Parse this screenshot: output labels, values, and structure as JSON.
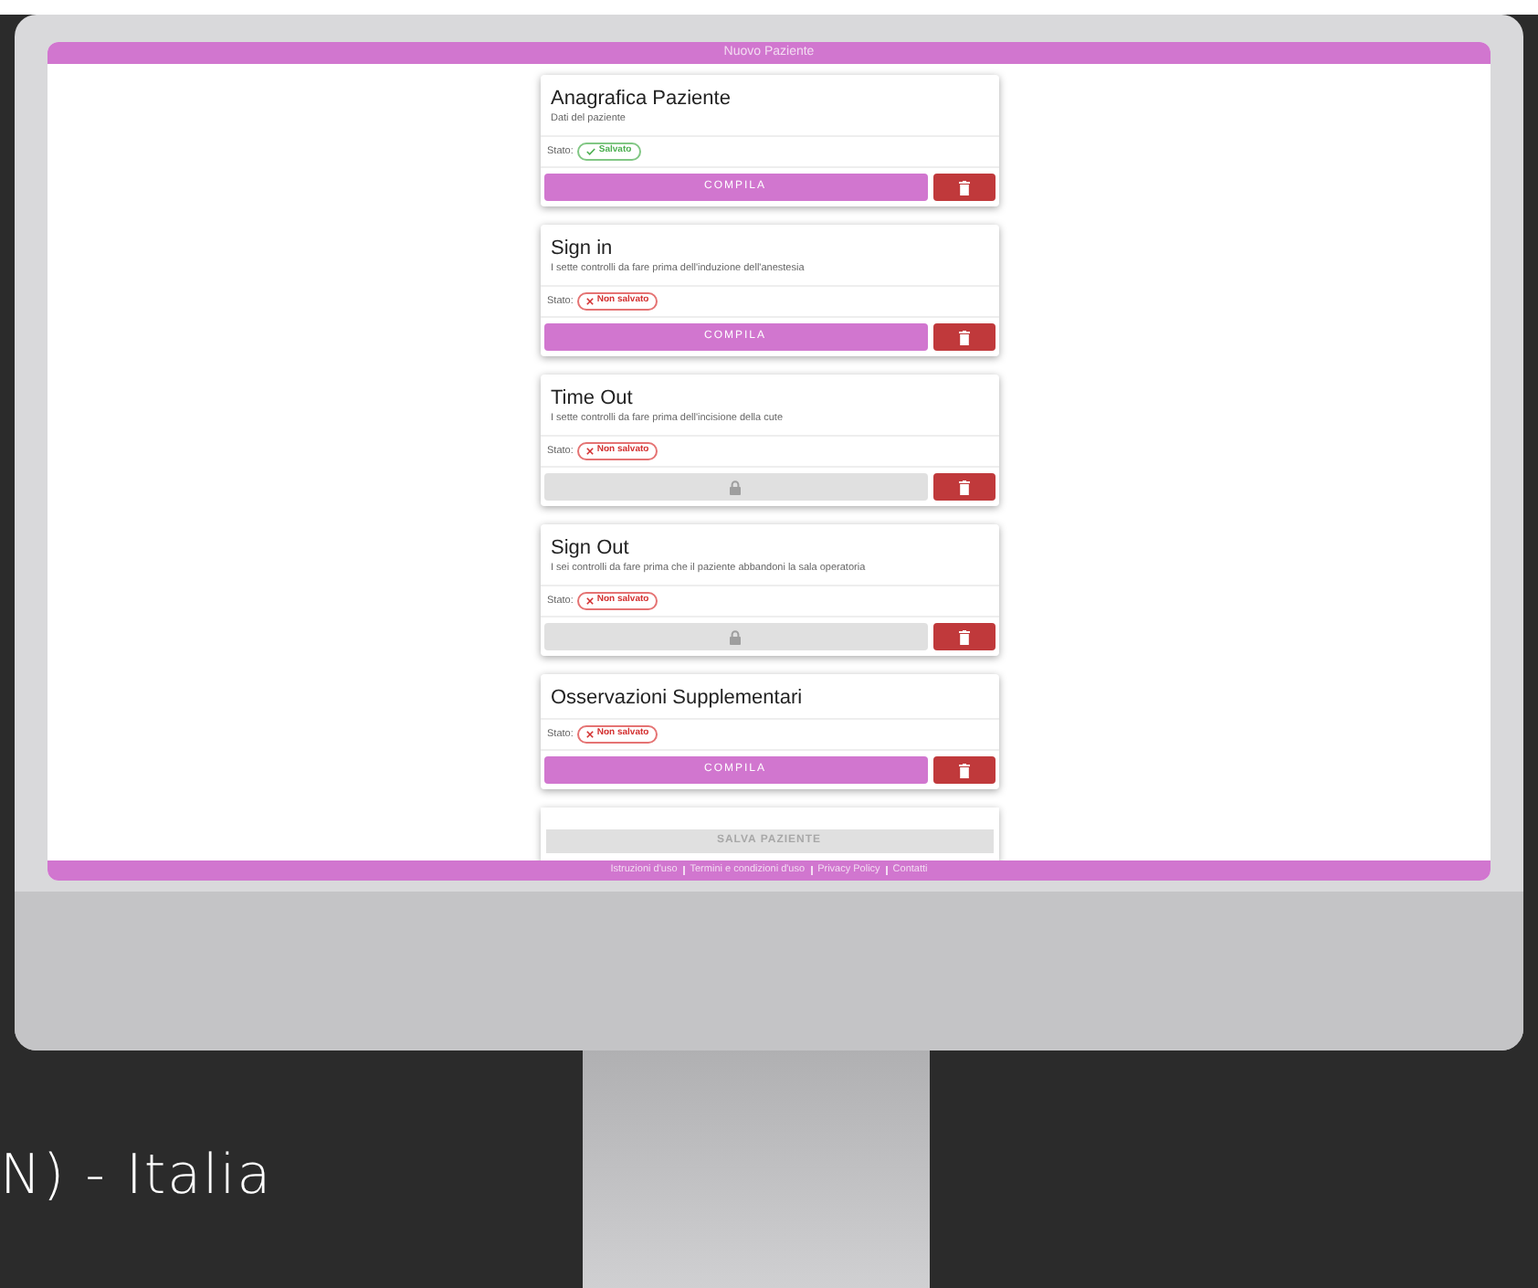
{
  "screen": {
    "title": "Nuovo Paziente",
    "cards": [
      {
        "title": "Anagrafica Paziente",
        "subtitle": "Dati del paziente",
        "status_label": "Stato:",
        "status": {
          "text": "Salvato",
          "saved": true
        },
        "action": {
          "kind": "compila",
          "label": "COMPILA"
        }
      },
      {
        "title": "Sign in",
        "subtitle": "I sette controlli da fare prima dell'induzione dell'anestesia",
        "status_label": "Stato:",
        "status": {
          "text": "Non salvato",
          "saved": false
        },
        "action": {
          "kind": "compila",
          "label": "COMPILA"
        }
      },
      {
        "title": "Time Out",
        "subtitle": "I sette controlli da fare prima dell'incisione della cute",
        "status_label": "Stato:",
        "status": {
          "text": "Non salvato",
          "saved": false
        },
        "action": {
          "kind": "locked"
        }
      },
      {
        "title": "Sign Out",
        "subtitle": "I sei controlli da fare prima che il paziente abbandoni la sala operatoria",
        "status_label": "Stato:",
        "status": {
          "text": "Non salvato",
          "saved": false
        },
        "action": {
          "kind": "locked"
        }
      },
      {
        "title": "Osservazioni Supplementari",
        "status_label": "Stato:",
        "status": {
          "text": "Non salvato",
          "saved": false
        },
        "action": {
          "kind": "compila",
          "label": "COMPILA"
        }
      }
    ],
    "save_button": {
      "label": "SALVA PAZIENTE",
      "disabled": true
    },
    "footer_links": [
      "Istruzioni d'uso",
      "Termini e condizioni d'uso",
      "Privacy Policy",
      "Contatti"
    ]
  },
  "caption": "N) - Italia"
}
